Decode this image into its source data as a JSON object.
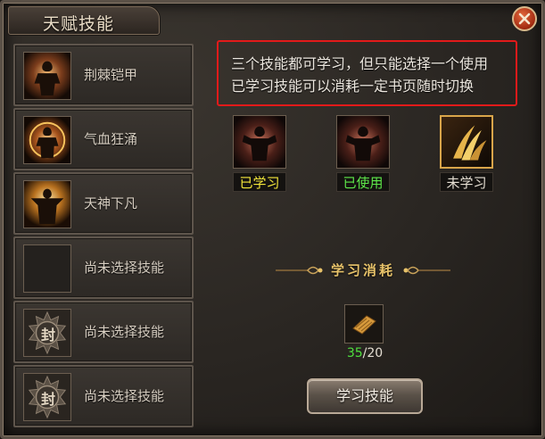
{
  "window": {
    "title": "天赋技能"
  },
  "skill_list": {
    "items": [
      {
        "label": "荆棘铠甲",
        "icon": "warrior-thorn-icon"
      },
      {
        "label": "气血狂涌",
        "icon": "warrior-surge-icon"
      },
      {
        "label": "天神下凡",
        "icon": "warrior-god-icon"
      },
      {
        "label": "尚未选择技能",
        "icon": "empty-slot-icon"
      },
      {
        "label": "尚未选择技能",
        "icon": "seal-lock-icon"
      },
      {
        "label": "尚未选择技能",
        "icon": "seal-lock-icon"
      }
    ],
    "seal_char": "封"
  },
  "notice": {
    "line1": "三个技能都可学习，但只能选择一个使用",
    "line2": "已学习技能可以消耗一定书页随时切换"
  },
  "choices": [
    {
      "status": "已学习",
      "status_color": "#f3e63a",
      "icon": "warrior-flex-icon"
    },
    {
      "status": "已使用",
      "status_color": "#5ee84a",
      "icon": "warrior-flex-icon"
    },
    {
      "status": "未学习",
      "status_color": "#e5ded2",
      "icon": "golden-claws-icon"
    }
  ],
  "cost": {
    "title": "学习消耗",
    "item_icon": "book-page-icon",
    "have": "35",
    "separator": "/",
    "need": "20"
  },
  "learn_button": {
    "label": "学习技能"
  },
  "colors": {
    "accent_gold": "#e8c36a",
    "notice_border": "#e21a1a"
  }
}
